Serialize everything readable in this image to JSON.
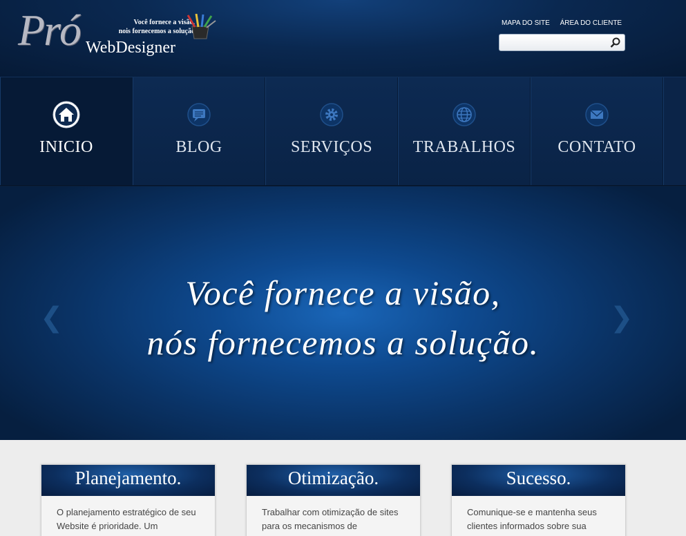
{
  "logo": {
    "mark": "Pró",
    "name": "WebDesigner",
    "tagline_line1": "Você fornece a visão,",
    "tagline_line2": "nois fornecemos a solução",
    "icon": "pencils-cup-icon"
  },
  "top_links": [
    "MAPA DO SITE",
    "ÁREA DO CLIENTE"
  ],
  "search": {
    "placeholder": "",
    "icon": "search-icon"
  },
  "nav": [
    {
      "label": "INICIO",
      "icon": "home-icon",
      "active": true
    },
    {
      "label": "BLOG",
      "icon": "chat-bubble-icon",
      "active": false
    },
    {
      "label": "SERVIÇOS",
      "icon": "gear-icon",
      "active": false
    },
    {
      "label": "TRABALHOS",
      "icon": "globe-icon",
      "active": false
    },
    {
      "label": "CONTATO",
      "icon": "envelope-icon",
      "active": false
    }
  ],
  "hero": {
    "line1": "Você fornece a visão,",
    "line2": "nós fornecemos a solução.",
    "prev": "❮",
    "next": "❯"
  },
  "features": [
    {
      "title": "Planejamento.",
      "text": "O planejamento estratégico de seu Website é prioridade. Um"
    },
    {
      "title": "Otimização.",
      "text": "Trabalhar com otimização de sites para os mecanismos de"
    },
    {
      "title": "Sucesso.",
      "text": "Comunique-se e mantenha seus clientes informados sobre sua"
    }
  ],
  "colors": {
    "header_bg": "#0a2850",
    "nav_bg": "#0a2244",
    "hero_glow": "#1a66b8",
    "content_bg": "#ededed"
  }
}
